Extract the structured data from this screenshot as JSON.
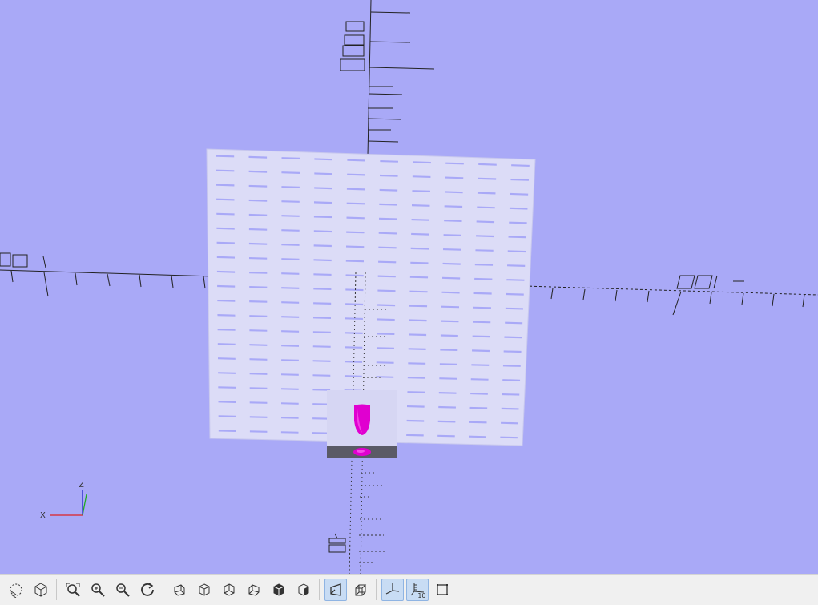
{
  "viewport": {
    "background": "#a9a9f7",
    "axis_indicator": {
      "x_label": "X",
      "z_label": "Z"
    },
    "model": {
      "grid_plate_color": "#dcdcf7",
      "hole_color": "#a9a9f7",
      "object_color": "#e400d0",
      "object_base_color": "#5a5a66",
      "grid_rows": 20,
      "grid_cols": 10
    }
  },
  "toolbar": {
    "buttons": [
      {
        "name": "preview-button",
        "icon": "preview-icon",
        "active": false
      },
      {
        "name": "render-button",
        "icon": "render-icon",
        "active": false
      },
      {
        "name": "view-all-button",
        "icon": "view-all-icon",
        "active": false
      },
      {
        "name": "zoom-in-button",
        "icon": "zoom-in-icon",
        "active": false
      },
      {
        "name": "zoom-out-button",
        "icon": "zoom-out-icon",
        "active": false
      },
      {
        "name": "reset-view-button",
        "icon": "reset-view-icon",
        "active": false
      },
      {
        "name": "right-view-button",
        "icon": "right-view-icon",
        "active": false
      },
      {
        "name": "top-view-button",
        "icon": "top-view-icon",
        "active": false
      },
      {
        "name": "bottom-view-button",
        "icon": "bottom-view-icon",
        "active": false
      },
      {
        "name": "left-view-button",
        "icon": "left-view-icon",
        "active": false
      },
      {
        "name": "front-view-button",
        "icon": "front-view-icon",
        "active": false
      },
      {
        "name": "back-view-button",
        "icon": "back-view-icon",
        "active": false
      },
      {
        "name": "perspective-button",
        "icon": "perspective-icon",
        "active": true
      },
      {
        "name": "orthogonal-button",
        "icon": "orthogonal-icon",
        "active": false
      },
      {
        "name": "show-axes-button",
        "icon": "axes-icon",
        "active": true
      },
      {
        "name": "show-scale-markers-button",
        "icon": "scale-markers-icon",
        "active": true
      },
      {
        "name": "show-edges-button",
        "icon": "edges-icon",
        "active": false
      }
    ],
    "scale_markers_label": "10"
  }
}
